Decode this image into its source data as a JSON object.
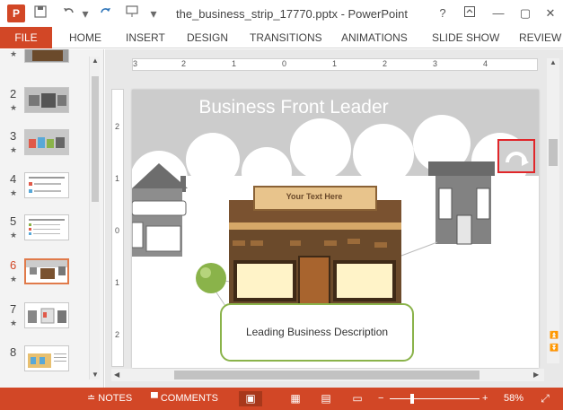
{
  "titlebar": {
    "app_icon": "P",
    "app_icon_name": "powerpoint-icon",
    "save_icon": "save-icon",
    "undo_icon": "undo-icon",
    "redo_icon": "redo-icon",
    "present_icon": "present-from-start-icon",
    "customize_icon": "customize-toolbar-icon",
    "title": "the_business_strip_17770.pptx - PowerPoint",
    "help": "?",
    "ribbon_options_icon": "ribbon-display-options-icon",
    "minimize_icon": "minimize-icon",
    "restore_icon": "restore-icon",
    "close_icon": "close-icon"
  },
  "ribbon": {
    "file_tab": "FILE",
    "tabs": [
      "HOME",
      "INSERT",
      "DESIGN",
      "TRANSITIONS",
      "ANIMATIONS",
      "SLIDE SHOW",
      "REVIEW"
    ]
  },
  "thumbnails": {
    "slides": [
      {
        "number": "",
        "star": "★"
      },
      {
        "number": "2",
        "star": "★"
      },
      {
        "number": "3",
        "star": "★"
      },
      {
        "number": "4",
        "star": "★"
      },
      {
        "number": "5",
        "star": "★"
      },
      {
        "number": "6",
        "star": "★",
        "active": true
      },
      {
        "number": "7",
        "star": "★"
      },
      {
        "number": "8",
        "star": ""
      }
    ]
  },
  "ruler": {
    "h_numbers": [
      "3",
      "2",
      "1",
      "0",
      "1",
      "2",
      "3",
      "4"
    ],
    "v_numbers": [
      "2",
      "1",
      "0",
      "1",
      "2"
    ]
  },
  "slide": {
    "title": "Business Front Leader",
    "sign_text": "Your Text Here",
    "description": "Leading Business Description",
    "animation_icon": "animation-undo-icon"
  },
  "statusbar": {
    "notes": "NOTES",
    "comments": "COMMENTS",
    "normal_view_icon": "normal-view-icon",
    "slide_sorter_icon": "slide-sorter-icon",
    "reading_view_icon": "reading-view-icon",
    "slideshow_icon": "slideshow-icon",
    "zoom_out": "−",
    "zoom_in": "+",
    "zoom_level": "58%",
    "fit_icon": "fit-to-window-icon",
    "zoom_fraction": 0.58
  },
  "colors": {
    "accent": "#d24726",
    "slide_bg": "#cccccc",
    "frame_green": "#8ab34a",
    "highlight_red": "#e0262a"
  }
}
